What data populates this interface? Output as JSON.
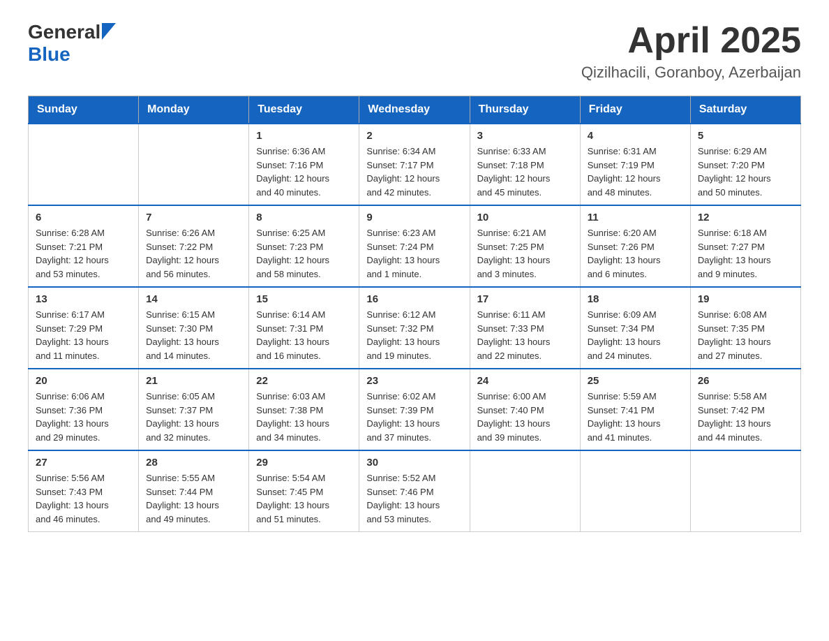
{
  "header": {
    "logo_general": "General",
    "logo_blue": "Blue",
    "title": "April 2025",
    "subtitle": "Qizilhacili, Goranboy, Azerbaijan"
  },
  "calendar": {
    "weekdays": [
      "Sunday",
      "Monday",
      "Tuesday",
      "Wednesday",
      "Thursday",
      "Friday",
      "Saturday"
    ],
    "weeks": [
      [
        {
          "day": "",
          "info": ""
        },
        {
          "day": "",
          "info": ""
        },
        {
          "day": "1",
          "info": "Sunrise: 6:36 AM\nSunset: 7:16 PM\nDaylight: 12 hours\nand 40 minutes."
        },
        {
          "day": "2",
          "info": "Sunrise: 6:34 AM\nSunset: 7:17 PM\nDaylight: 12 hours\nand 42 minutes."
        },
        {
          "day": "3",
          "info": "Sunrise: 6:33 AM\nSunset: 7:18 PM\nDaylight: 12 hours\nand 45 minutes."
        },
        {
          "day": "4",
          "info": "Sunrise: 6:31 AM\nSunset: 7:19 PM\nDaylight: 12 hours\nand 48 minutes."
        },
        {
          "day": "5",
          "info": "Sunrise: 6:29 AM\nSunset: 7:20 PM\nDaylight: 12 hours\nand 50 minutes."
        }
      ],
      [
        {
          "day": "6",
          "info": "Sunrise: 6:28 AM\nSunset: 7:21 PM\nDaylight: 12 hours\nand 53 minutes."
        },
        {
          "day": "7",
          "info": "Sunrise: 6:26 AM\nSunset: 7:22 PM\nDaylight: 12 hours\nand 56 minutes."
        },
        {
          "day": "8",
          "info": "Sunrise: 6:25 AM\nSunset: 7:23 PM\nDaylight: 12 hours\nand 58 minutes."
        },
        {
          "day": "9",
          "info": "Sunrise: 6:23 AM\nSunset: 7:24 PM\nDaylight: 13 hours\nand 1 minute."
        },
        {
          "day": "10",
          "info": "Sunrise: 6:21 AM\nSunset: 7:25 PM\nDaylight: 13 hours\nand 3 minutes."
        },
        {
          "day": "11",
          "info": "Sunrise: 6:20 AM\nSunset: 7:26 PM\nDaylight: 13 hours\nand 6 minutes."
        },
        {
          "day": "12",
          "info": "Sunrise: 6:18 AM\nSunset: 7:27 PM\nDaylight: 13 hours\nand 9 minutes."
        }
      ],
      [
        {
          "day": "13",
          "info": "Sunrise: 6:17 AM\nSunset: 7:29 PM\nDaylight: 13 hours\nand 11 minutes."
        },
        {
          "day": "14",
          "info": "Sunrise: 6:15 AM\nSunset: 7:30 PM\nDaylight: 13 hours\nand 14 minutes."
        },
        {
          "day": "15",
          "info": "Sunrise: 6:14 AM\nSunset: 7:31 PM\nDaylight: 13 hours\nand 16 minutes."
        },
        {
          "day": "16",
          "info": "Sunrise: 6:12 AM\nSunset: 7:32 PM\nDaylight: 13 hours\nand 19 minutes."
        },
        {
          "day": "17",
          "info": "Sunrise: 6:11 AM\nSunset: 7:33 PM\nDaylight: 13 hours\nand 22 minutes."
        },
        {
          "day": "18",
          "info": "Sunrise: 6:09 AM\nSunset: 7:34 PM\nDaylight: 13 hours\nand 24 minutes."
        },
        {
          "day": "19",
          "info": "Sunrise: 6:08 AM\nSunset: 7:35 PM\nDaylight: 13 hours\nand 27 minutes."
        }
      ],
      [
        {
          "day": "20",
          "info": "Sunrise: 6:06 AM\nSunset: 7:36 PM\nDaylight: 13 hours\nand 29 minutes."
        },
        {
          "day": "21",
          "info": "Sunrise: 6:05 AM\nSunset: 7:37 PM\nDaylight: 13 hours\nand 32 minutes."
        },
        {
          "day": "22",
          "info": "Sunrise: 6:03 AM\nSunset: 7:38 PM\nDaylight: 13 hours\nand 34 minutes."
        },
        {
          "day": "23",
          "info": "Sunrise: 6:02 AM\nSunset: 7:39 PM\nDaylight: 13 hours\nand 37 minutes."
        },
        {
          "day": "24",
          "info": "Sunrise: 6:00 AM\nSunset: 7:40 PM\nDaylight: 13 hours\nand 39 minutes."
        },
        {
          "day": "25",
          "info": "Sunrise: 5:59 AM\nSunset: 7:41 PM\nDaylight: 13 hours\nand 41 minutes."
        },
        {
          "day": "26",
          "info": "Sunrise: 5:58 AM\nSunset: 7:42 PM\nDaylight: 13 hours\nand 44 minutes."
        }
      ],
      [
        {
          "day": "27",
          "info": "Sunrise: 5:56 AM\nSunset: 7:43 PM\nDaylight: 13 hours\nand 46 minutes."
        },
        {
          "day": "28",
          "info": "Sunrise: 5:55 AM\nSunset: 7:44 PM\nDaylight: 13 hours\nand 49 minutes."
        },
        {
          "day": "29",
          "info": "Sunrise: 5:54 AM\nSunset: 7:45 PM\nDaylight: 13 hours\nand 51 minutes."
        },
        {
          "day": "30",
          "info": "Sunrise: 5:52 AM\nSunset: 7:46 PM\nDaylight: 13 hours\nand 53 minutes."
        },
        {
          "day": "",
          "info": ""
        },
        {
          "day": "",
          "info": ""
        },
        {
          "day": "",
          "info": ""
        }
      ]
    ]
  }
}
